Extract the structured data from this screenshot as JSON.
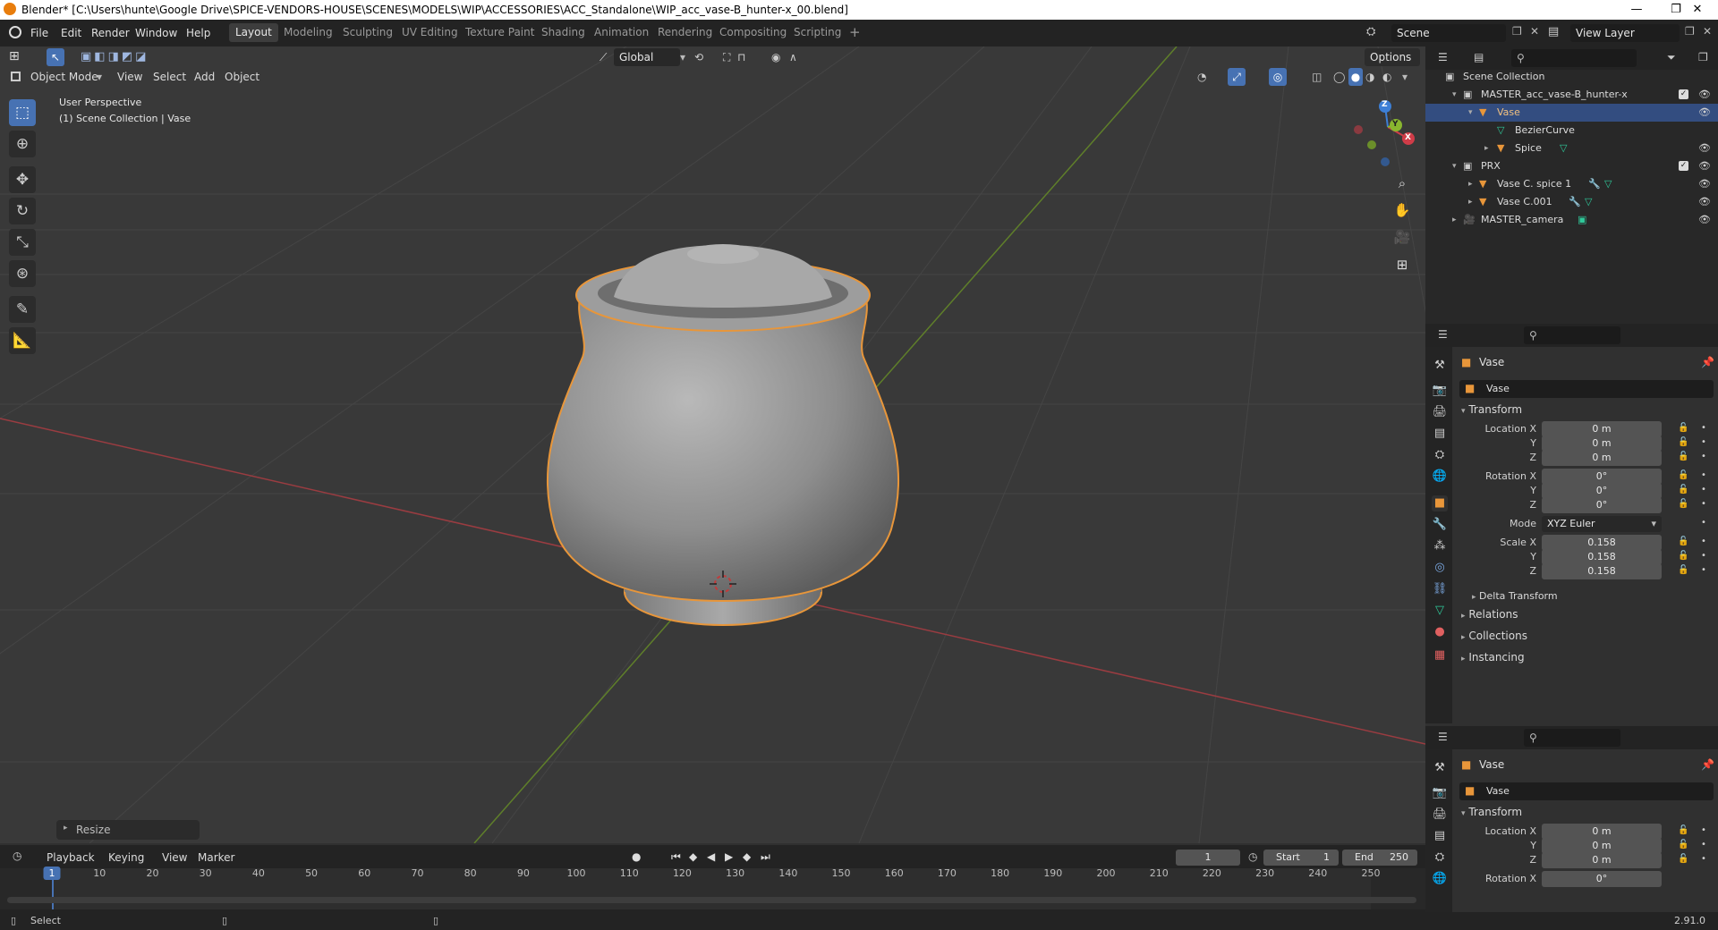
{
  "titlebar": {
    "title": "Blender* [C:\\Users\\hunte\\Google Drive\\SPICE-VENDORS-HOUSE\\SCENES\\MODELS\\WIP\\ACCESSORIES\\ACC_Standalone\\WIP_acc_vase-B_hunter-x_00.blend]",
    "minimize": "—",
    "maximize": "❐",
    "close": "✕"
  },
  "menu": [
    "File",
    "Edit",
    "Render",
    "Window",
    "Help"
  ],
  "workspaces": [
    "Layout",
    "Modeling",
    "Sculpting",
    "UV Editing",
    "Texture Paint",
    "Shading",
    "Animation",
    "Rendering",
    "Compositing",
    "Scripting"
  ],
  "add_workspace": "+",
  "scene": {
    "name": "Scene",
    "view_layer": "View Layer"
  },
  "viewport": {
    "mode": "Object Mode",
    "menus": [
      "View",
      "Select",
      "Add",
      "Object"
    ],
    "orientation": "Global",
    "options_label": "Options",
    "overlay_line1": "User Perspective",
    "overlay_line2": "(1) Scene Collection | Vase",
    "operator_panel": "Resize",
    "gizmo": {
      "z": "Z",
      "y": "Y",
      "x": "X"
    }
  },
  "outliner": {
    "root": "Scene Collection",
    "items": [
      {
        "label": "MASTER_acc_vase-B_hunter-x"
      },
      {
        "label": "Vase"
      },
      {
        "label": "BezierCurve"
      },
      {
        "label": "Spice"
      },
      {
        "label": "PRX"
      },
      {
        "label": "Vase C. spice 1"
      },
      {
        "label": "Vase C.001"
      },
      {
        "label": "MASTER_camera"
      }
    ]
  },
  "properties": {
    "object_name": "Vase",
    "data_name": "Vase",
    "transform_title": "Transform",
    "location_label": "Location X",
    "location": [
      "0 m",
      "0 m",
      "0 m"
    ],
    "rotation_label": "Rotation X",
    "rotation": [
      "0°",
      "0°",
      "0°"
    ],
    "mode_label": "Mode",
    "mode_value": "XYZ Euler",
    "scale_label": "Scale X",
    "scale": [
      "0.158",
      "0.158",
      "0.158"
    ],
    "axis_y": "Y",
    "axis_z": "Z",
    "delta": "Delta Transform",
    "relations": "Relations",
    "collections": "Collections",
    "instancing": "Instancing"
  },
  "properties2": {
    "object_name": "Vase",
    "data_name": "Vase",
    "transform_title": "Transform",
    "location_label": "Location X",
    "location": [
      "0 m",
      "0 m",
      "0 m"
    ],
    "rotation_label": "Rotation X",
    "rotation_value": "0°"
  },
  "timeline": {
    "menus": [
      "Playback",
      "Keying",
      "View",
      "Marker"
    ],
    "current_frame": "1",
    "start_label": "Start",
    "start": "1",
    "end_label": "End",
    "end": "250",
    "ticks": [
      "1",
      "10",
      "20",
      "30",
      "40",
      "50",
      "60",
      "70",
      "80",
      "90",
      "100",
      "110",
      "120",
      "130",
      "140",
      "150",
      "160",
      "170",
      "180",
      "190",
      "200",
      "210",
      "220",
      "230",
      "240",
      "250"
    ]
  },
  "status": {
    "left": "Select",
    "version": "2.91.0"
  },
  "colors": {
    "selection": "#e8963a",
    "accent": "#4772b3",
    "x_axis": "#b2393f",
    "y_axis": "#6a8d27"
  }
}
